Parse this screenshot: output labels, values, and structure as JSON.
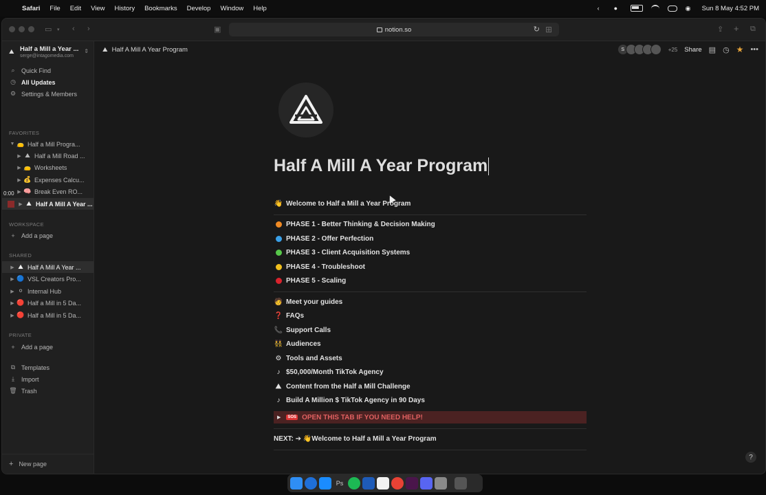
{
  "menubar": {
    "app": "Safari",
    "menus": [
      "File",
      "Edit",
      "View",
      "History",
      "Bookmarks",
      "Develop",
      "Window",
      "Help"
    ],
    "datetime": "Sun 8 May  4:52 PM"
  },
  "browser": {
    "url": "notion.so"
  },
  "sidebar": {
    "workspace_name": "Half a Mill a Year ...",
    "workspace_email": "serge@intagomedia.com",
    "top_items": [
      {
        "label": "Quick Find",
        "icon": "search-icon"
      },
      {
        "label": "All Updates",
        "icon": "clock-icon"
      },
      {
        "label": "Settings & Members",
        "icon": "gear-icon"
      }
    ],
    "favorites_label": "FAVORITES",
    "favorites": [
      {
        "label": "Half a Mill Progra...",
        "emoji": "👝"
      },
      {
        "label": "Half a Mill Road ...",
        "emoji": "⛰"
      },
      {
        "label": "Worksheets",
        "emoji": "👝"
      },
      {
        "label": "Expenses Calcu...",
        "emoji": "💰"
      },
      {
        "label": "Break Even RO...",
        "emoji": "🧠"
      },
      {
        "label": "Half A Mill A Year ...",
        "emoji": "⛰"
      }
    ],
    "timecode": "0:00",
    "workspace_label": "WORKSPACE",
    "add_page": "Add a page",
    "shared_label": "SHARED",
    "shared": [
      {
        "label": "Half A Mill A Year ...",
        "emoji": "⛰"
      },
      {
        "label": "VSL Creators Pro...",
        "emoji": "🔵"
      },
      {
        "label": "Internal Hub",
        "emoji": "⚪"
      },
      {
        "label": "Half a Mill in 5 Da...",
        "emoji": "🔴"
      },
      {
        "label": "Half a Mill in 5 Da...",
        "emoji": "🔴"
      }
    ],
    "private_label": "PRIVATE",
    "bottom_items": [
      {
        "label": "Templates",
        "icon": "templates-icon"
      },
      {
        "label": "Import",
        "icon": "import-icon"
      },
      {
        "label": "Trash",
        "icon": "trash-icon"
      }
    ],
    "new_page": "New page"
  },
  "topbar": {
    "breadcrumb": "Half A Mill A Year Program",
    "avatar_initial": "S",
    "extra_count": "+25",
    "share": "Share"
  },
  "page": {
    "title": "Half A Mill A Year Program",
    "welcome": {
      "emoji": "👋",
      "label": "Welcome to Half a Mill a Year Program"
    },
    "phases": [
      {
        "label": "PHASE 1 - Better Thinking & Decision Making",
        "color": "#f08a24"
      },
      {
        "label": "PHASE 2 - Offer Perfection",
        "color": "#3aa0e8"
      },
      {
        "label": "PHASE 3 - Client Acquisition Systems",
        "color": "#57c84a"
      },
      {
        "label": "PHASE 4 - Troubleshoot",
        "color": "#f2c01e"
      },
      {
        "label": "PHASE 5 - Scaling",
        "color": "#d9232d"
      }
    ],
    "resources": [
      {
        "emoji": "🧑",
        "label": "Meet your guides"
      },
      {
        "emoji": "❓",
        "label": "FAQs"
      },
      {
        "emoji": "📞",
        "label": "Support Calls"
      },
      {
        "emoji": "👯",
        "label": "Audiences"
      },
      {
        "emoji": "⚙",
        "label": "Tools and Assets"
      },
      {
        "emoji": "♪",
        "label": "$50,000/Month TikTok Agency"
      },
      {
        "emoji": "⛰",
        "label": "Content from the Half a Mill Challenge"
      },
      {
        "emoji": "♪",
        "label": "Build A Million $ TikTok Agency in 90 Days"
      }
    ],
    "help_toggle": "OPEN THIS TAB IF YOU NEED HELP!",
    "sos": "SOS",
    "next_prefix": "NEXT: ➔ ",
    "next_emoji": "👋",
    "next_link": "Welcome to Half a Mill a Year Program",
    "help_button": "?"
  }
}
